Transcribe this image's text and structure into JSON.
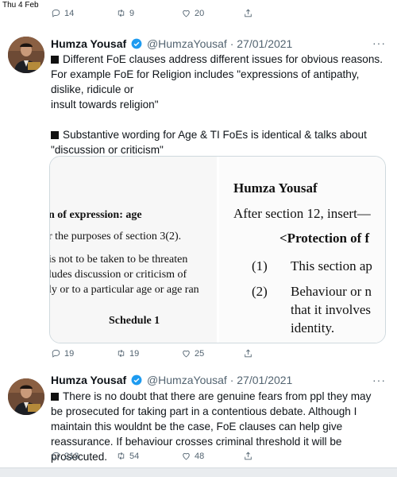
{
  "status_bar": {
    "date": "Thu 4 Feb"
  },
  "previous_tweet_actions": {
    "replies": "14",
    "retweets": "9",
    "likes": "20"
  },
  "tweets": [
    {
      "author_name": "Humza Yousaf",
      "handle": "@HumzaYousaf",
      "separator": "·",
      "date": "27/01/2021",
      "more": "···",
      "paragraphs": [
        "Different FoE clauses address different issues for obvious reasons. For example FoE for Religion includes \"expressions of antipathy, dislike, ridicule or",
        "insult towards religion\"",
        "Substantive wording for Age & TI FoEs is identical & talks about \"discussion or criticism\""
      ],
      "media": {
        "left_doc": {
          "line1": "n of expression: age",
          "line2": "r the purposes of section 3(2).",
          "line3": " is not to be taken to be threaten",
          "line4": "ludes discussion or criticism of",
          "line5": "ly or to a particular age or age ran",
          "line6": "Schedule 1"
        },
        "right_doc": {
          "line1": "Humza Yousaf",
          "line2": "After section 12, insert—",
          "line3": "<Protection of f",
          "line4_num": "(1)",
          "line4_text": "This section ap",
          "line5_num": "(2)",
          "line5_text": "Behaviour or n",
          "line6": "that it involves",
          "line7": "identity."
        }
      },
      "actions": {
        "replies": "19",
        "retweets": "19",
        "likes": "25"
      }
    },
    {
      "author_name": "Humza Yousaf",
      "handle": "@HumzaYousaf",
      "separator": "·",
      "date": "27/01/2021",
      "more": "···",
      "paragraphs": [
        "There is no doubt that there are genuine fears from ppl they may be prosecuted for taking part in a contentious debate. Although I maintain this wouldnt be the case, FoE clauses can help give reassurance. If behaviour crosses criminal threshold it will be prosecuted."
      ],
      "actions": {
        "replies": "213",
        "retweets": "54",
        "likes": "48"
      }
    }
  ]
}
